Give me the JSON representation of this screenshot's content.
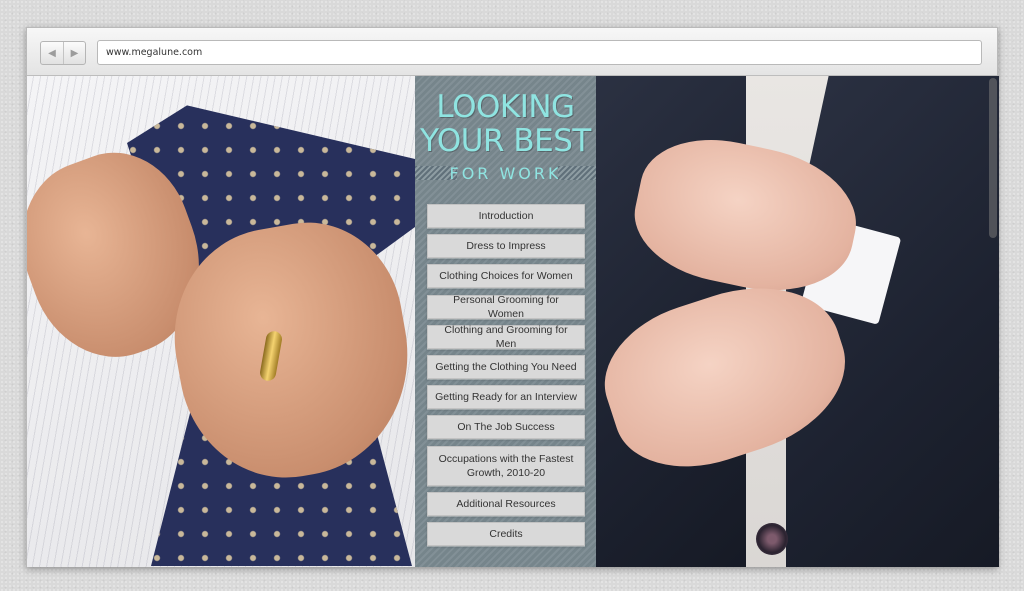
{
  "browser": {
    "back_label": "◀",
    "forward_label": "▶",
    "url": "www.megalune.com"
  },
  "hero": {
    "title_line1": "LOOKING",
    "title_line2": "YOUR BEST",
    "subtitle": "FOR WORK",
    "accent_color": "#8fe4e1",
    "panel_color": "#7b8a91"
  },
  "menu": {
    "items": [
      {
        "label": "Introduction"
      },
      {
        "label": "Dress to Impress"
      },
      {
        "label": "Clothing Choices for Women"
      },
      {
        "label": "Personal Grooming for Women"
      },
      {
        "label": "Clothing and Grooming for Men"
      },
      {
        "label": "Getting the Clothing You Need"
      },
      {
        "label": "Getting Ready for an Interview"
      },
      {
        "label": "On The Job Success"
      },
      {
        "label": "Occupations with the Fastest Growth, 2010-20"
      },
      {
        "label": "Additional Resources"
      },
      {
        "label": "Credits"
      }
    ]
  }
}
